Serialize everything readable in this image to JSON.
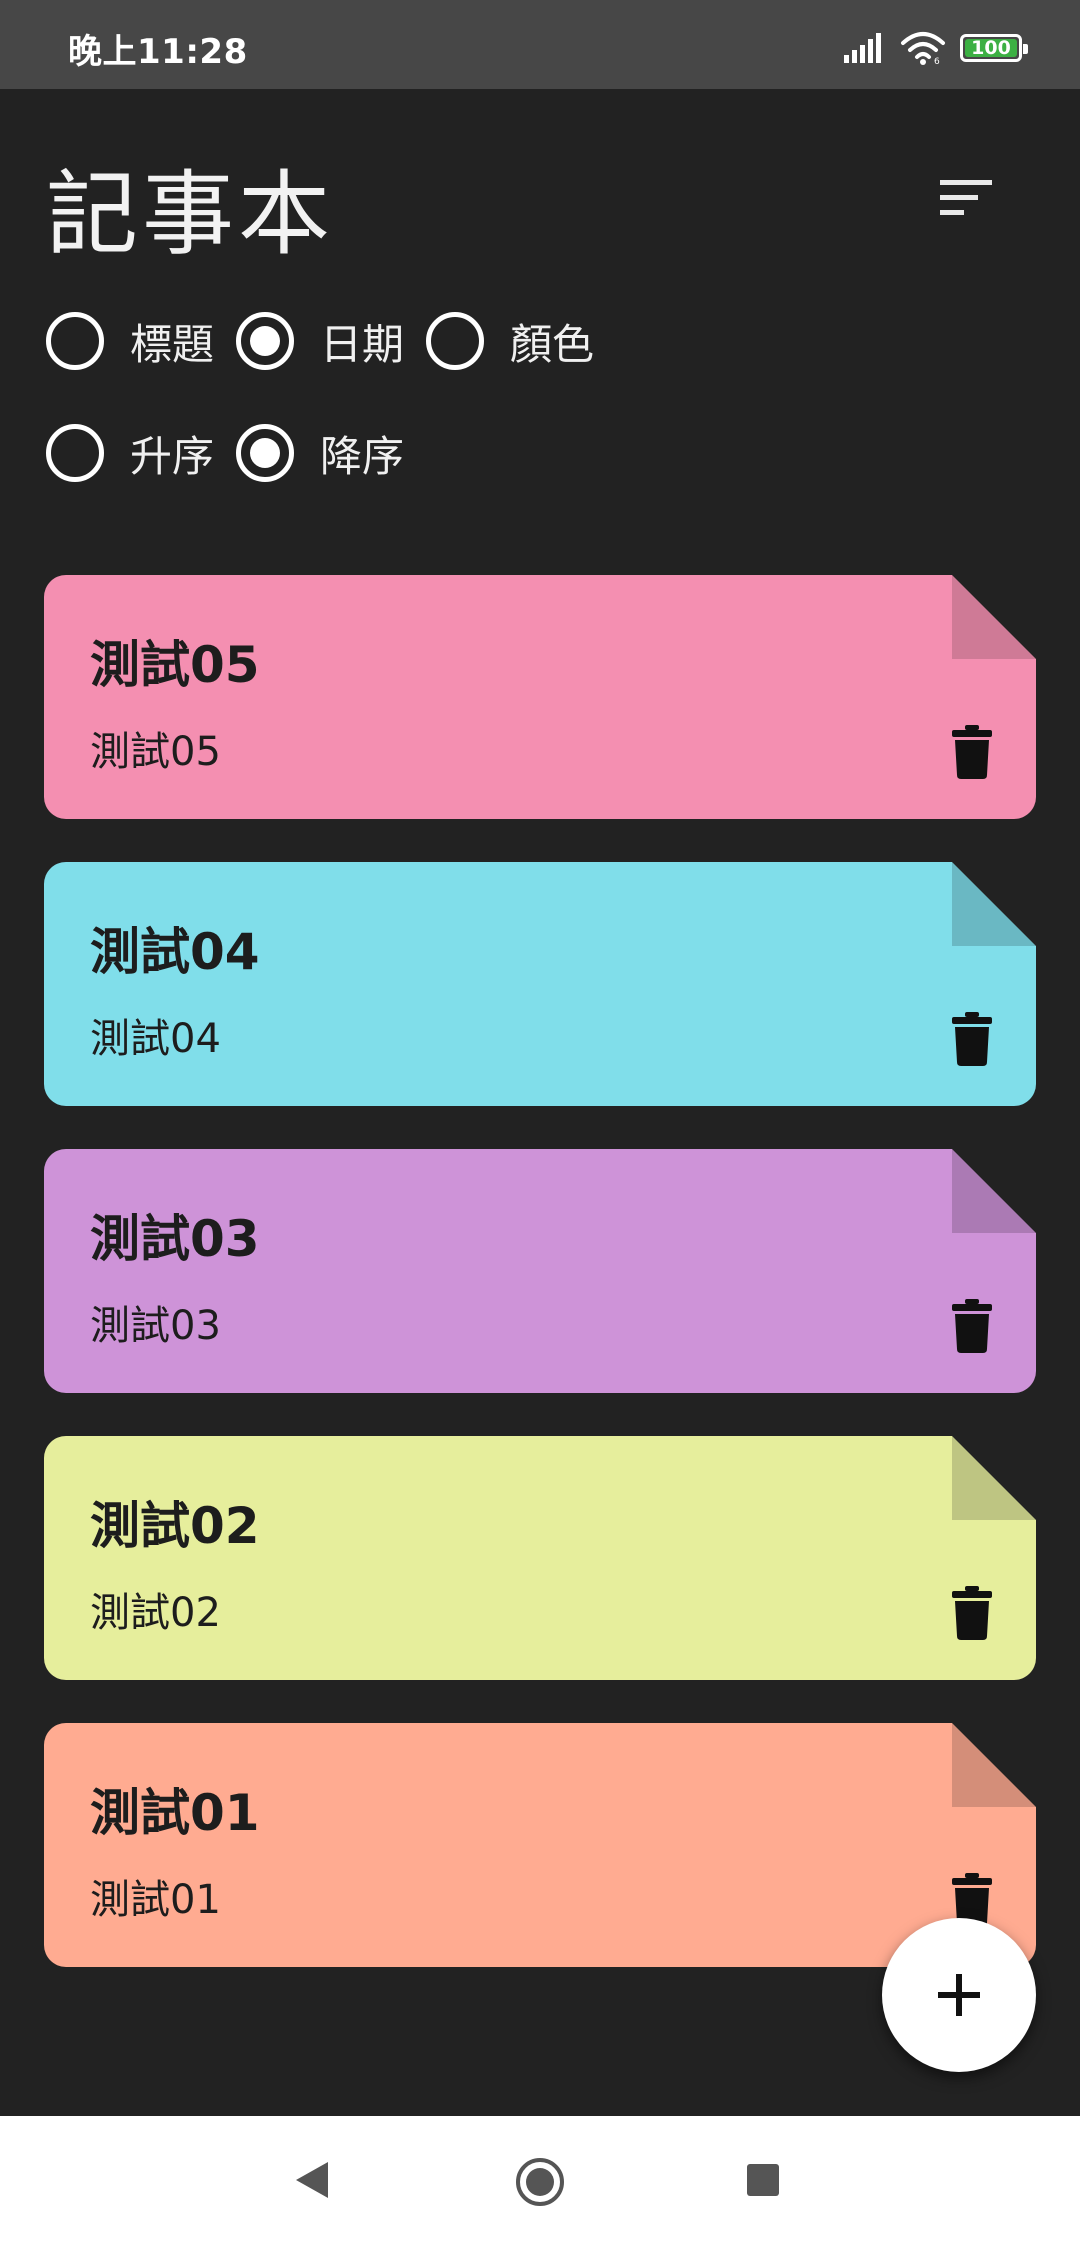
{
  "status": {
    "time": "晚上11:28",
    "battery_level": 100,
    "battery_text": "100",
    "icons": [
      "signal-icon",
      "wifi-icon",
      "battery-icon"
    ]
  },
  "header": {
    "title": "記事本",
    "sort_icon": "sort-icon"
  },
  "sort_by": {
    "options": [
      {
        "label": "標題",
        "checked": false
      },
      {
        "label": "日期",
        "checked": true
      },
      {
        "label": "顏色",
        "checked": false
      }
    ]
  },
  "order": {
    "options": [
      {
        "label": "升序",
        "checked": false
      },
      {
        "label": "降序",
        "checked": true
      }
    ]
  },
  "notes": [
    {
      "title": "測試05",
      "body": "測試05",
      "color": "#f48fb1",
      "fold_color": "#cf7a96"
    },
    {
      "title": "測試04",
      "body": "測試04",
      "color": "#80deea",
      "fold_color": "#6ab8c3"
    },
    {
      "title": "測試03",
      "body": "測試03",
      "color": "#ce93d8",
      "fold_color": "#ab7ab4"
    },
    {
      "title": "測試02",
      "body": "測試02",
      "color": "#e6ee9c",
      "fold_color": "#bec582"
    },
    {
      "title": "測試01",
      "body": "測試01",
      "color": "#ffab91",
      "fold_color": "#d48e79"
    }
  ],
  "fab": {
    "icon": "plus-icon"
  },
  "navigation": {
    "icons": [
      "back-icon",
      "home-icon",
      "recents-icon"
    ]
  }
}
